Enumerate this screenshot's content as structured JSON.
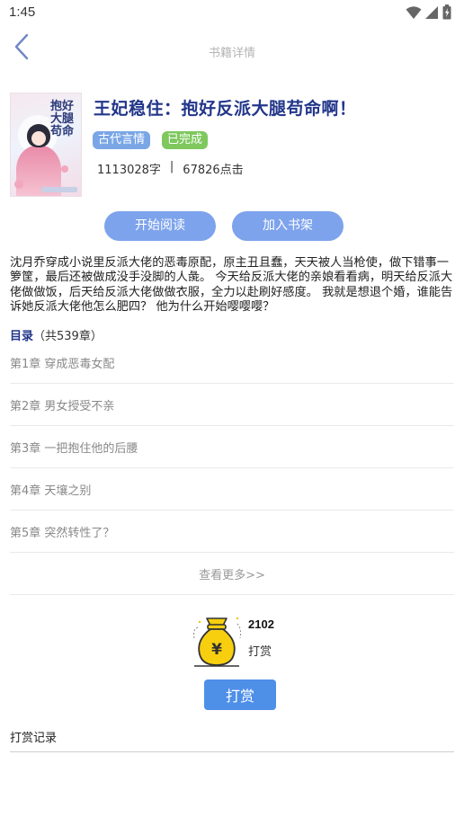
{
  "status_bar": {
    "time": "1:45"
  },
  "nav": {
    "title": "书籍详情"
  },
  "book": {
    "title": "王妃稳住：抱好反派大腿苟命啊！",
    "cover_text": "抱好大腿苟命",
    "tags": {
      "genre": "古代言情",
      "status": "已完成"
    },
    "word_count": "1113028字",
    "separator": "|",
    "clicks": "67826点击"
  },
  "actions": {
    "read": "开始阅读",
    "shelf": "加入书架"
  },
  "synopsis": "沈月乔穿成小说里反派大佬的恶毒原配，原主丑且蠢，天天被人当枪使，做下错事一箩筐，最后还被做成没手没脚的人彘。 今天给反派大佬的亲娘看看病，明天给反派大佬做做饭，后天给反派大佬做做衣服，全力以赴刷好感度。 我就是想退个婚，谁能告诉她反派大佬他怎么肥四？ 他为什么开始嘤嘤嘤？",
  "catalog": {
    "label": "目录",
    "count": "（共539章）",
    "chapters": [
      "第1章 穿成恶毒女配",
      "第2章 男女授受不亲",
      "第3章 一把抱住他的后腰",
      "第4章 天壤之别",
      "第5章 突然转性了？"
    ],
    "more": "查看更多>>"
  },
  "reward": {
    "count": "2102",
    "label": "打赏",
    "button": "打赏",
    "bag_symbol": "¥"
  },
  "records": {
    "title": "打赏记录"
  },
  "colors": {
    "accent": "#7da3ec",
    "title": "#22368a",
    "genre_tag": "#7aa6e6",
    "status_tag": "#7ec85e",
    "reward_button": "#4e8fe8"
  },
  "icons": [
    "wifi-icon",
    "signal-icon",
    "battery-icon",
    "back-arrow-icon",
    "money-bag-icon"
  ]
}
